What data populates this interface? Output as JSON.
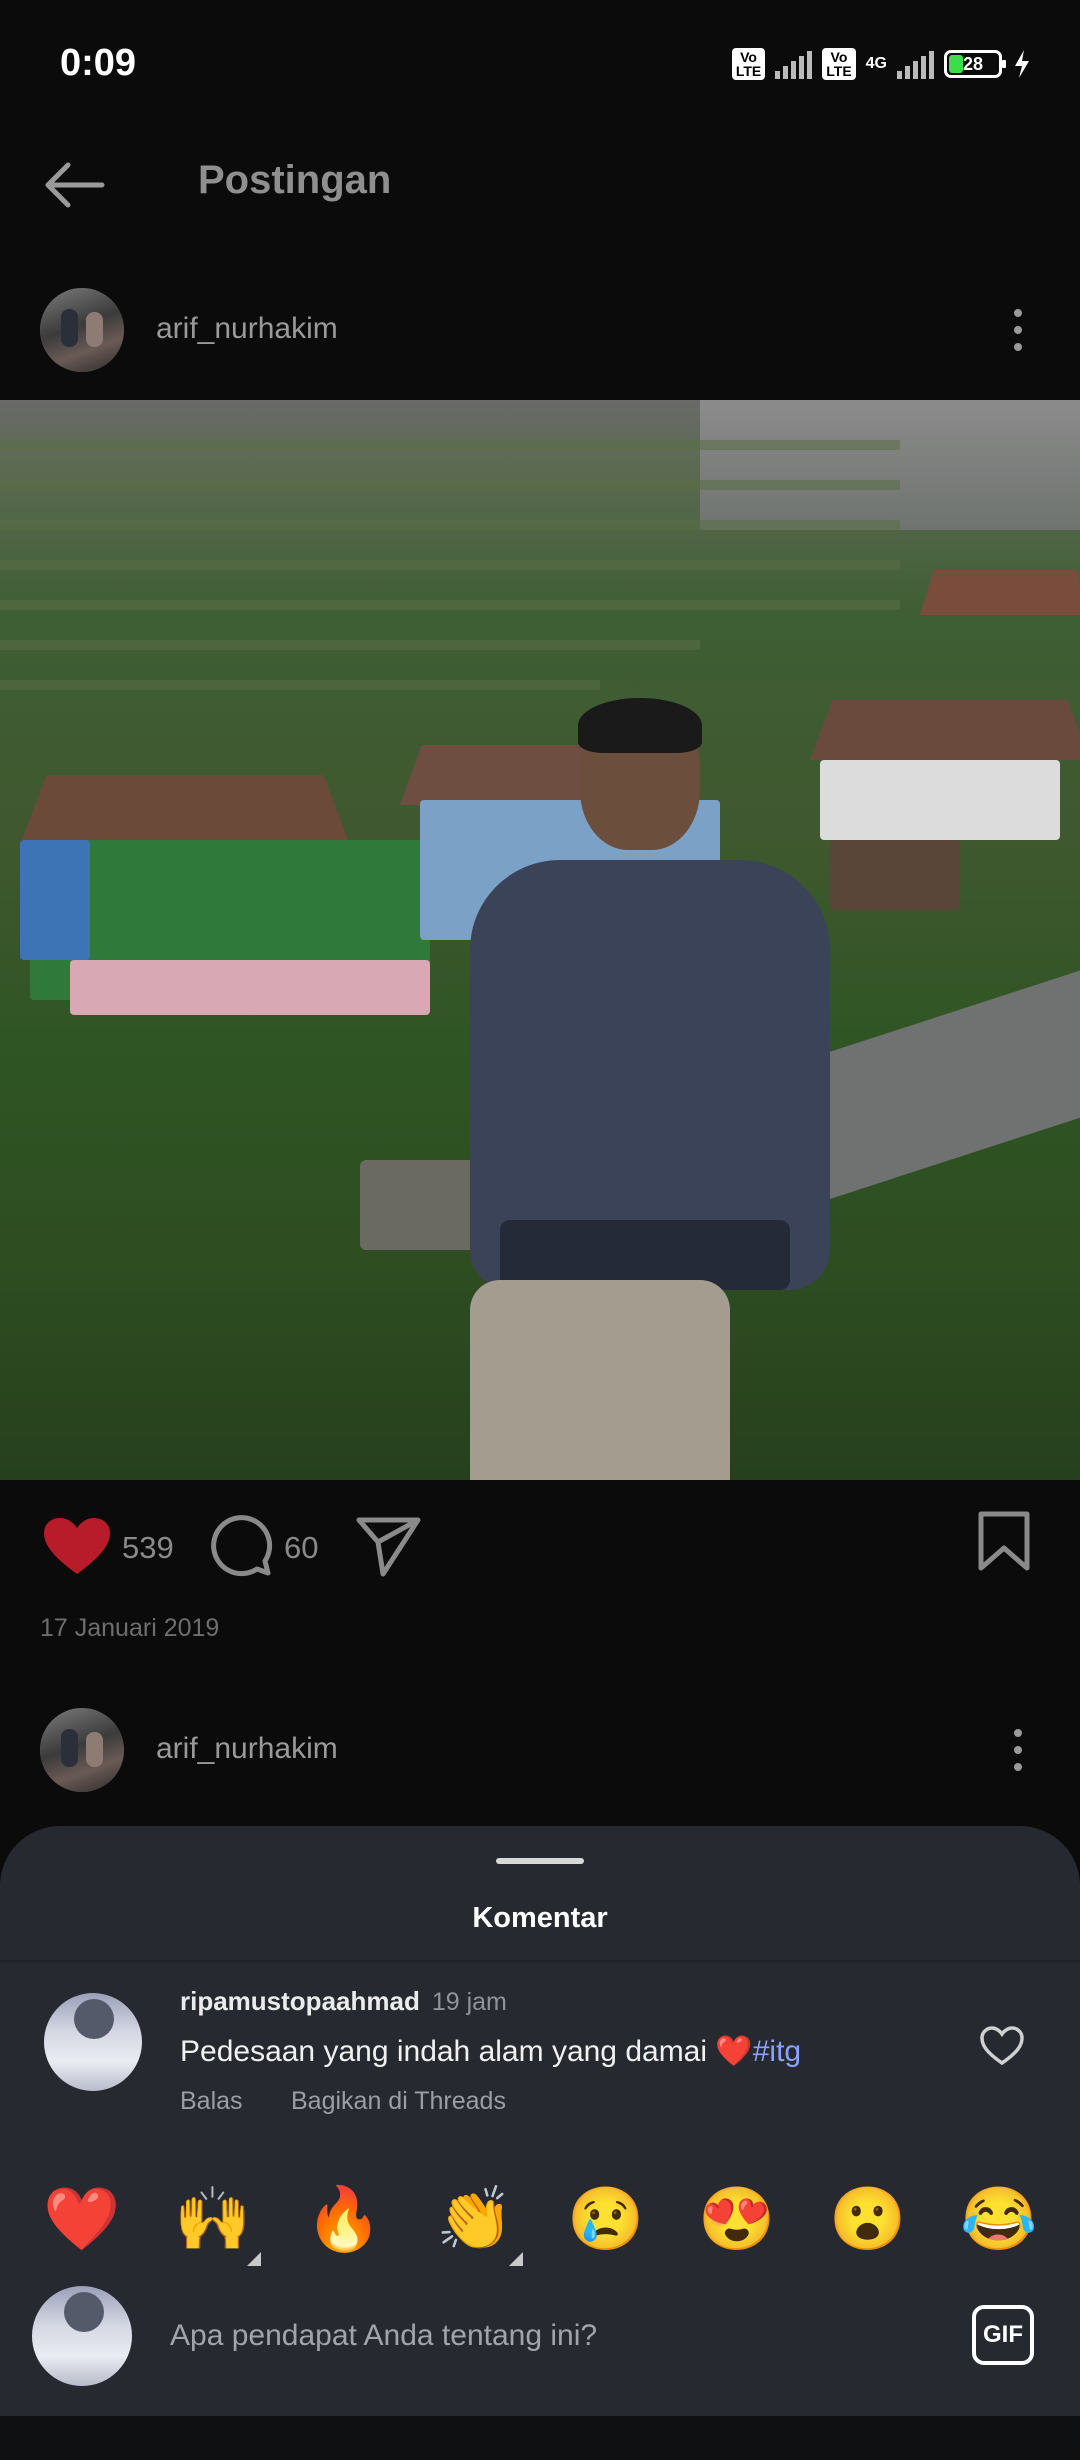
{
  "status_bar": {
    "time": "0:09",
    "volte": "Vo LTE",
    "network": "4G",
    "battery": "28"
  },
  "header": {
    "title": "Postingan"
  },
  "post": {
    "username": "arif_nurhakim",
    "likes": "539",
    "comments": "60",
    "date": "17 Januari 2019"
  },
  "next_post": {
    "username": "arif_nurhakim"
  },
  "comments_sheet": {
    "title": "Komentar",
    "comment": {
      "username": "ripamustopaahmad",
      "time": "19 jam",
      "text": "Pedesaan yang indah alam yang damai ",
      "heart": "❤️",
      "hashtag": "#itg",
      "reply_label": "Balas",
      "share_label": "Bagikan di Threads"
    },
    "emojis": [
      "❤️",
      "🙌",
      "🔥",
      "👏",
      "😢",
      "😍",
      "😮",
      "😂"
    ],
    "input_placeholder": "Apa pendapat Anda tentang ini?",
    "gif_label": "GIF"
  },
  "colors": {
    "like_red": "#b81c2a",
    "hashtag": "#8aa2ff",
    "sheet_bg": "#262a30"
  }
}
